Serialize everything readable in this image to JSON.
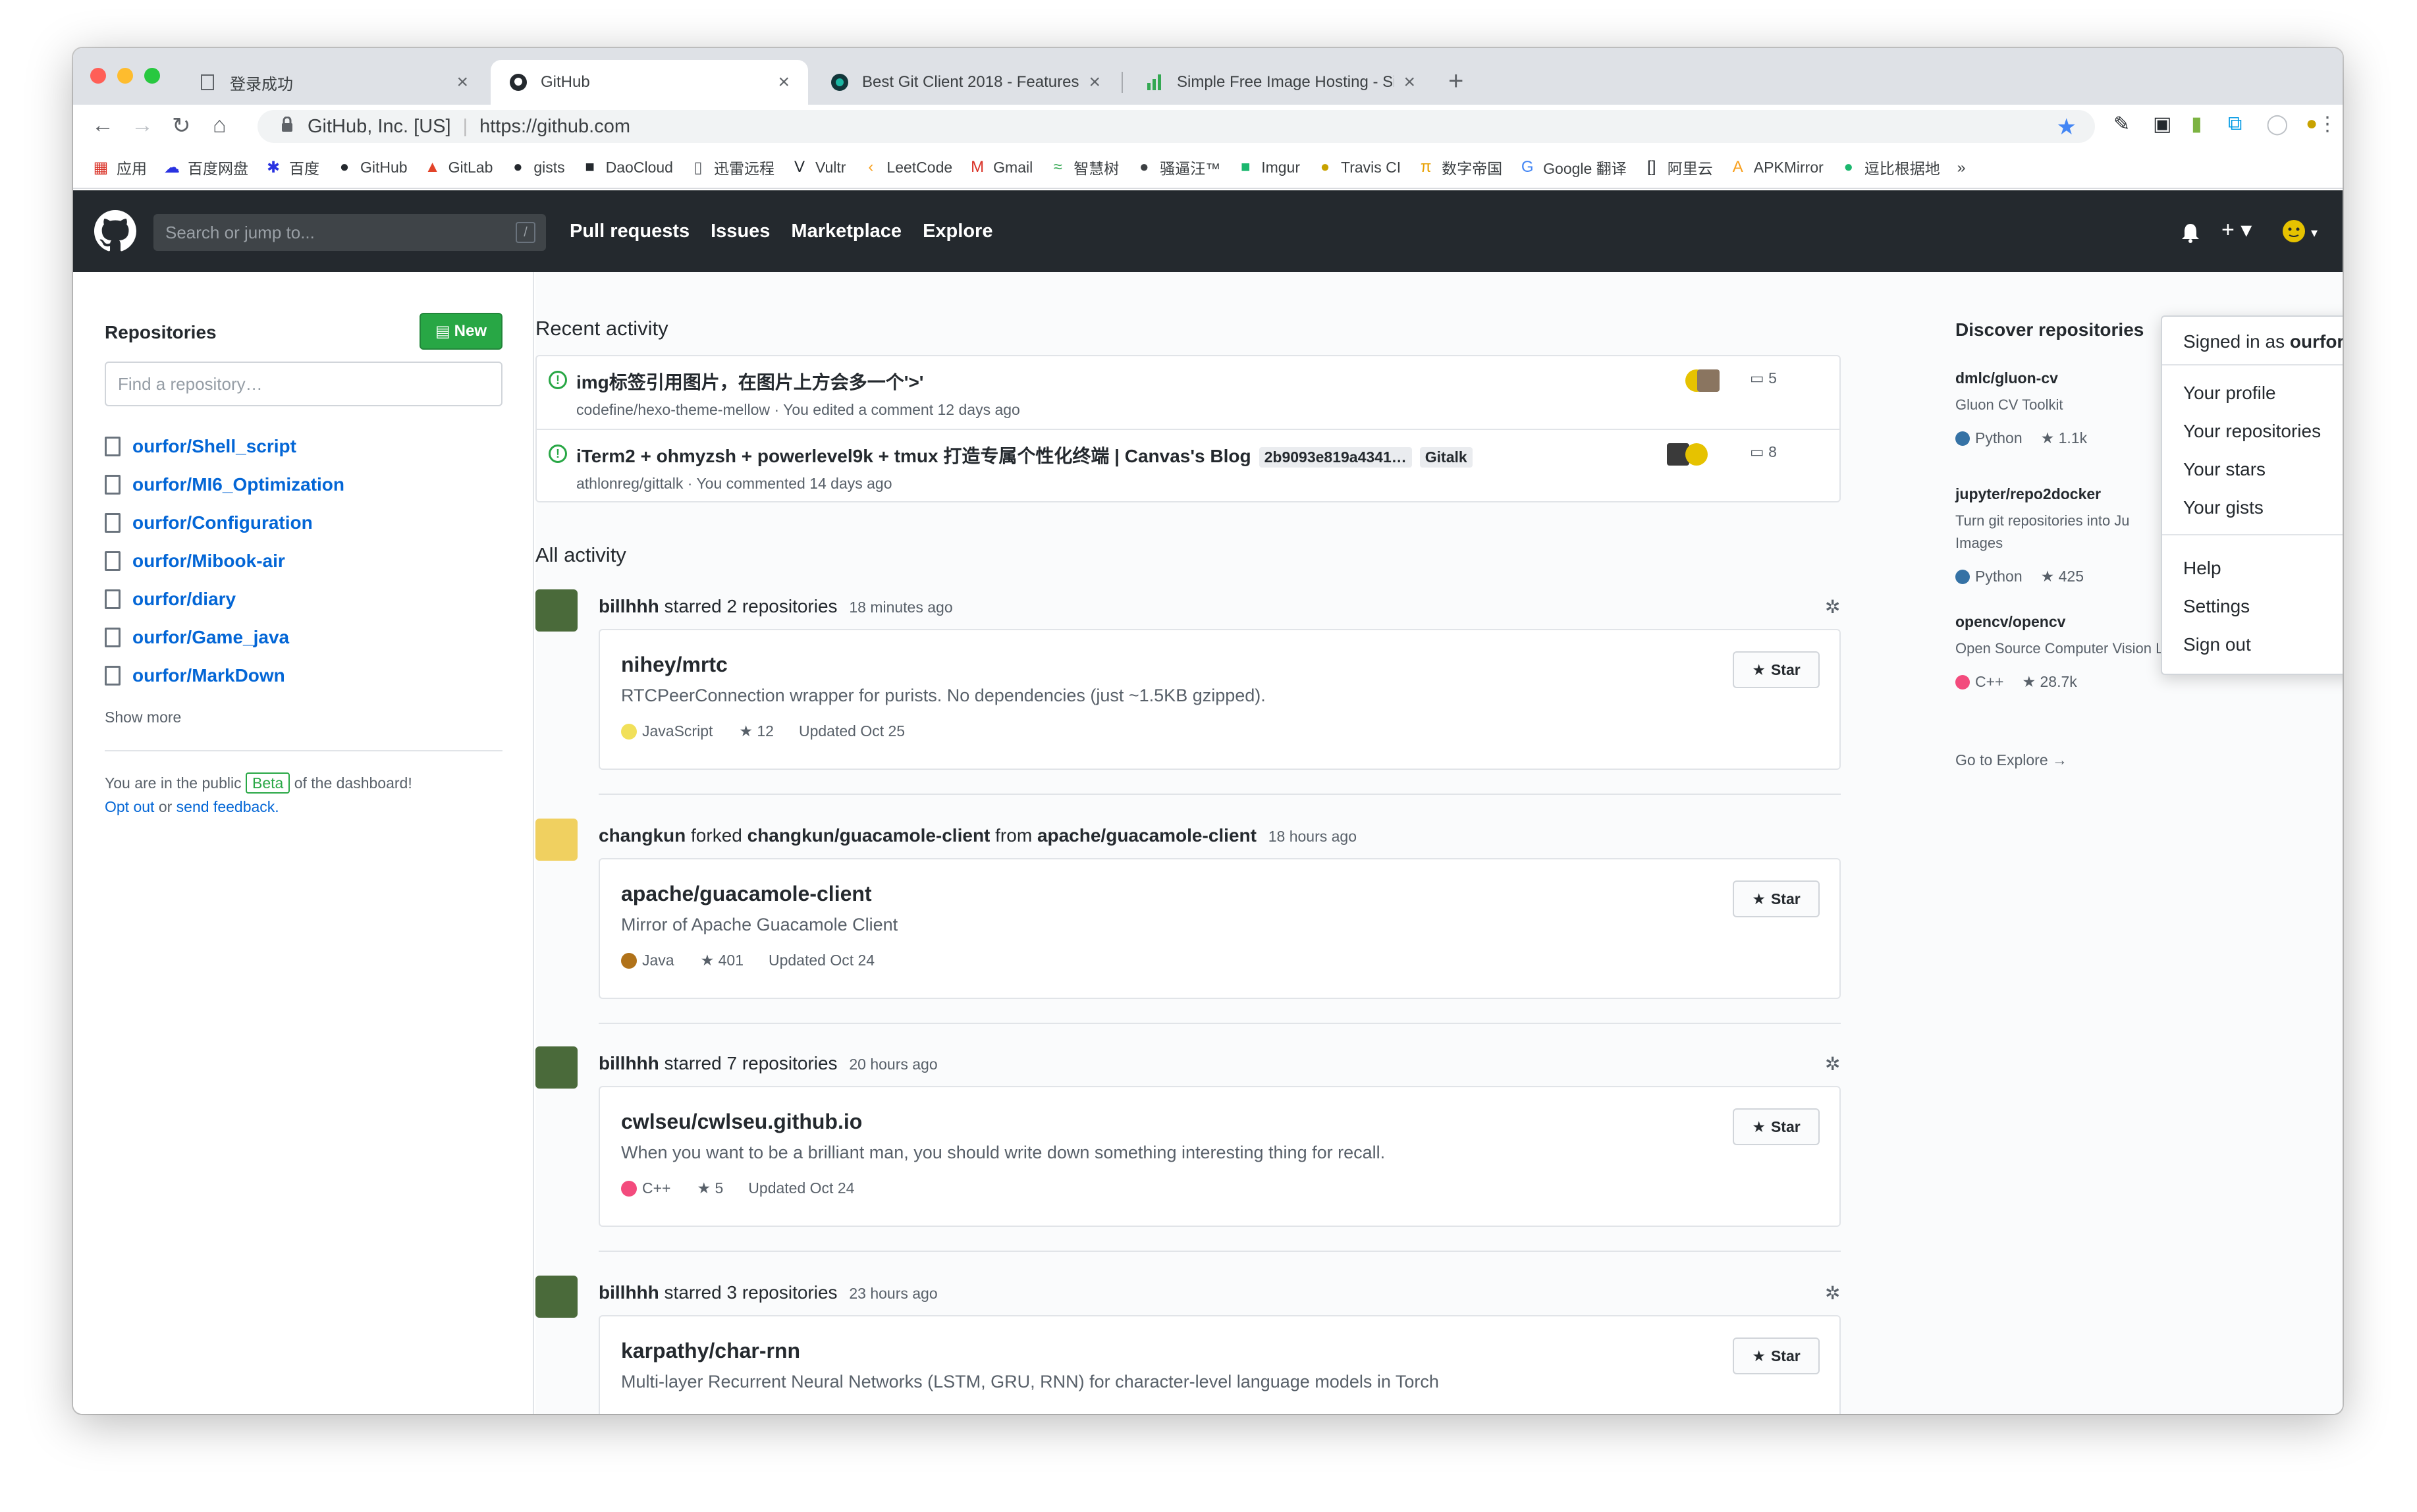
{
  "browser": {
    "tabs": [
      {
        "title": "登录成功",
        "active": false
      },
      {
        "title": "GitHub",
        "active": true
      },
      {
        "title": "Best Git Client 2018 - Features",
        "active": false
      },
      {
        "title": "Simple Free Image Hosting - Si",
        "active": false
      }
    ],
    "new_tab": "+",
    "address": {
      "org": "GitHub, Inc. [US]",
      "url": "https://github.com"
    },
    "bookmarks": [
      {
        "label": "应用",
        "icon": "apps-grid-icon",
        "glyph": "▦",
        "color": "#d93025"
      },
      {
        "label": "百度网盘",
        "icon": "baidu-pan-icon",
        "glyph": "☁",
        "color": "#2932e1"
      },
      {
        "label": "百度",
        "icon": "baidu-paw-icon",
        "glyph": "✱",
        "color": "#2932e1"
      },
      {
        "label": "GitHub",
        "icon": "github-icon",
        "glyph": "●",
        "color": "#24292e"
      },
      {
        "label": "GitLab",
        "icon": "gitlab-fox-icon",
        "glyph": "▲",
        "color": "#e24329"
      },
      {
        "label": "gists",
        "icon": "github-icon",
        "glyph": "●",
        "color": "#24292e"
      },
      {
        "label": "DaoCloud",
        "icon": "daocloud-icon",
        "glyph": "■",
        "color": "#24292e"
      },
      {
        "label": "迅雷远程",
        "icon": "page-icon",
        "glyph": "▯",
        "color": "#5f6368"
      },
      {
        "label": "Vultr",
        "icon": "vultr-v-icon",
        "glyph": "V",
        "color": "#24292e"
      },
      {
        "label": "LeetCode",
        "icon": "leetcode-icon",
        "glyph": "‹",
        "color": "#f89f1b"
      },
      {
        "label": "Gmail",
        "icon": "gmail-m-icon",
        "glyph": "M",
        "color": "#d93025"
      },
      {
        "label": "智慧树",
        "icon": "wave-icon",
        "glyph": "≈",
        "color": "#34a853"
      },
      {
        "label": "骚逼汪™",
        "icon": "dog-icon",
        "glyph": "●",
        "color": "#3c4043"
      },
      {
        "label": "Imgur",
        "icon": "imgur-icon",
        "glyph": "■",
        "color": "#1bb76e"
      },
      {
        "label": "Travis CI",
        "icon": "travis-icon",
        "glyph": "●",
        "color": "#c8a200"
      },
      {
        "label": "数字帝国",
        "icon": "pi-icon",
        "glyph": "π",
        "color": "#e8a000"
      },
      {
        "label": "Google 翻译",
        "icon": "google-translate-icon",
        "glyph": "G",
        "color": "#4285f4"
      },
      {
        "label": "阿里云",
        "icon": "aliyun-icon",
        "glyph": "[]",
        "color": "#24292e"
      },
      {
        "label": "APKMirror",
        "icon": "apkmirror-icon",
        "glyph": "A",
        "color": "#f89f1b"
      },
      {
        "label": "逗比根据地",
        "icon": "doubi-icon",
        "glyph": "●",
        "color": "#1bb76e"
      }
    ],
    "bookmarks_more": "»"
  },
  "header": {
    "search_placeholder": "Search or jump to...",
    "slash_hint": "/",
    "nav": [
      "Pull requests",
      "Issues",
      "Marketplace",
      "Explore"
    ],
    "plus": "+ ▾",
    "avatar_caret": "▾"
  },
  "sidebar": {
    "title": "Repositories",
    "new_button": "New",
    "find_placeholder": "Find a repository…",
    "repos": [
      "ourfor/Shell_script",
      "ourfor/MI6_Optimization",
      "ourfor/Configuration",
      "ourfor/Mibook-air",
      "ourfor/diary",
      "ourfor/Game_java",
      "ourfor/MarkDown"
    ],
    "show_more": "Show more",
    "beta_text_1": "You are in the public",
    "beta_tag": "Beta",
    "beta_text_2": "of the dashboard!",
    "opt_out": "Opt out",
    "or": "or",
    "send_feedback": "send feedback."
  },
  "recent": {
    "title": "Recent activity",
    "items": [
      {
        "title": "img标签引用图片，在图片上方会多一个'>'",
        "repo": "codefine/hexo-theme-mellow",
        "sep": "·",
        "meta": "You edited a comment 12 days ago",
        "comments": "5",
        "code": "",
        "label": ""
      },
      {
        "title": "iTerm2 + ohmyzsh + powerlevel9k + tmux 打造专属个性化终端 | Canvas's Blog",
        "repo": "athlonreg/gittalk",
        "sep": "·",
        "meta": "You commented 14 days ago",
        "comments": "8",
        "code": "2b9093e819a4341…",
        "label": "Gitalk"
      }
    ]
  },
  "all_activity": {
    "title": "All activity",
    "items": [
      {
        "user": "billhhh",
        "action": "starred 2 repositories",
        "time": "18 minutes ago",
        "mid": "",
        "target": "",
        "repo": "nihey/mrtc",
        "desc": "RTCPeerConnection wrapper for purists. No dependencies (just ~1.5KB gzipped).",
        "lang": "JavaScript",
        "lang_color": "#f1e05a",
        "stars": "12",
        "updated": "Updated Oct 25",
        "star_label": "Star"
      },
      {
        "user": "changkun",
        "action": "forked",
        "time": "18 hours ago",
        "mid": "changkun/guacamole-client",
        "from": "from",
        "target": "apache/guacamole-client",
        "repo": "apache/guacamole-client",
        "desc": "Mirror of Apache Guacamole Client",
        "lang": "Java",
        "lang_color": "#b07219",
        "stars": "401",
        "updated": "Updated Oct 24",
        "star_label": "Star"
      },
      {
        "user": "billhhh",
        "action": "starred 7 repositories",
        "time": "20 hours ago",
        "mid": "",
        "target": "",
        "repo": "cwlseu/cwlseu.github.io",
        "desc": "When you want to be a brilliant man, you should write down something interesting thing for recall.",
        "lang": "C++",
        "lang_color": "#f34b7d",
        "stars": "5",
        "updated": "Updated Oct 24",
        "star_label": "Star"
      },
      {
        "user": "billhhh",
        "action": "starred 3 repositories",
        "time": "23 hours ago",
        "mid": "",
        "target": "",
        "repo": "karpathy/char-rnn",
        "desc": "Multi-layer Recurrent Neural Networks (LSTM, GRU, RNN) for character-level language models in Torch",
        "lang": "",
        "lang_color": "",
        "stars": "",
        "updated": "",
        "star_label": "Star"
      }
    ]
  },
  "discover": {
    "title": "Discover repositories",
    "repos": [
      {
        "name": "dmlc/gluon-cv",
        "desc": "Gluon CV Toolkit",
        "lang": "Python",
        "lang_color": "#3572a5",
        "stars": "1.1k"
      },
      {
        "name": "jupyter/repo2docker",
        "desc": "Turn git repositories into Ju",
        "desc2": "Images",
        "lang": "Python",
        "lang_color": "#3572a5",
        "stars": "425"
      },
      {
        "name": "opencv/opencv",
        "desc": "Open Source Computer Vision Library",
        "lang": "C++",
        "lang_color": "#f34b7d",
        "stars": "28.7k"
      }
    ],
    "explore": "Go to Explore →"
  },
  "dropdown": {
    "signed_in": "Signed in as",
    "username": "ourfor",
    "items_1": [
      "Your profile",
      "Your repositories",
      "Your stars",
      "Your gists"
    ],
    "items_2": [
      "Help",
      "Settings",
      "Sign out"
    ]
  }
}
